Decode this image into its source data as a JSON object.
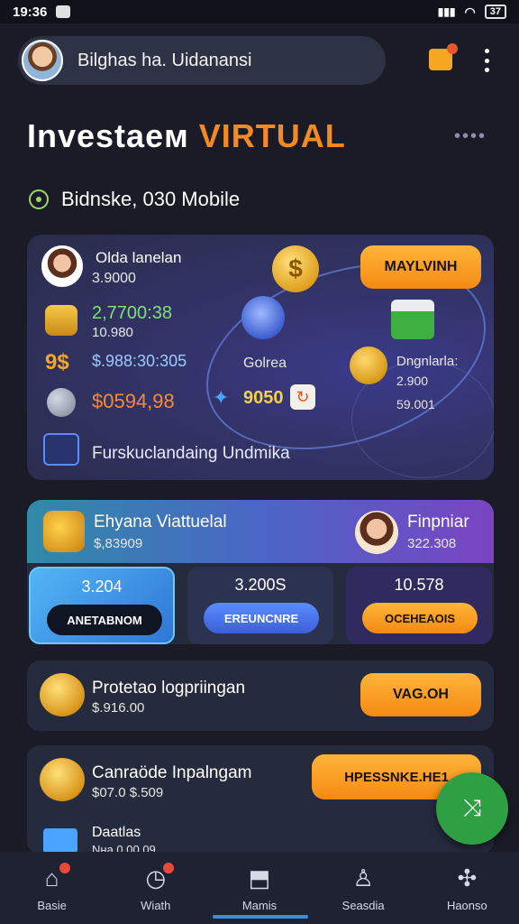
{
  "status_bar": {
    "time": "19:36",
    "battery": "37"
  },
  "header": {
    "profile_name": "Bilghas ha. Uidanansi"
  },
  "hero": {
    "title_part1": "Investaeм",
    "title_part2": "VIRTUAL",
    "more": "••••"
  },
  "subtitle": "Bidnske, 030 Mobile",
  "main_card": {
    "name": "Olda lanelan",
    "amount": "3.9000",
    "green_value": "2,7700:38",
    "white_value": "10.980",
    "blue_value": "$.988:30:305",
    "orange_value": "$0594,98",
    "coin_symbol": "$",
    "cta_label": "MAYLVINH",
    "orbit_label": "Golrea",
    "mid_value": "9050",
    "right_label": "Dngnlarla:",
    "right_value1": "2.900",
    "right_value2": "59.001",
    "bottom_text": "Furskuclandaing Undmika"
  },
  "virtual_card": {
    "title": "Ehyana Viattuelal",
    "amount": "$,83909",
    "right_title": "Finpniar",
    "right_amount": "322.308",
    "stats": [
      {
        "value": "3.204",
        "button": "ANETABNOM"
      },
      {
        "value": "3.200S",
        "button": "EREUNCNRE"
      },
      {
        "value": "10.578",
        "button": "OCEHEAOIS"
      }
    ]
  },
  "row1": {
    "title": "Protetao logpriingan",
    "amount": "$.916.00",
    "button": "VAG.OH"
  },
  "row2": {
    "title": "Canraöde Inpalngam",
    "amount": "$07.0 $.509",
    "button": "HPESSNKE.HE1",
    "sub_title": "Daatlas",
    "sub_amount": "Nна 0.00.09"
  },
  "nav": [
    {
      "label": "Basie",
      "icon": "home-icon"
    },
    {
      "label": "Wiath",
      "icon": "clock-icon"
    },
    {
      "label": "Mamis",
      "icon": "bag-icon"
    },
    {
      "label": "Seasdia",
      "icon": "person-icon"
    },
    {
      "label": "Haonso",
      "icon": "network-icon"
    }
  ],
  "colors": {
    "accent": "#f58a24",
    "background": "#1a1b26",
    "fab": "#2ea043"
  }
}
